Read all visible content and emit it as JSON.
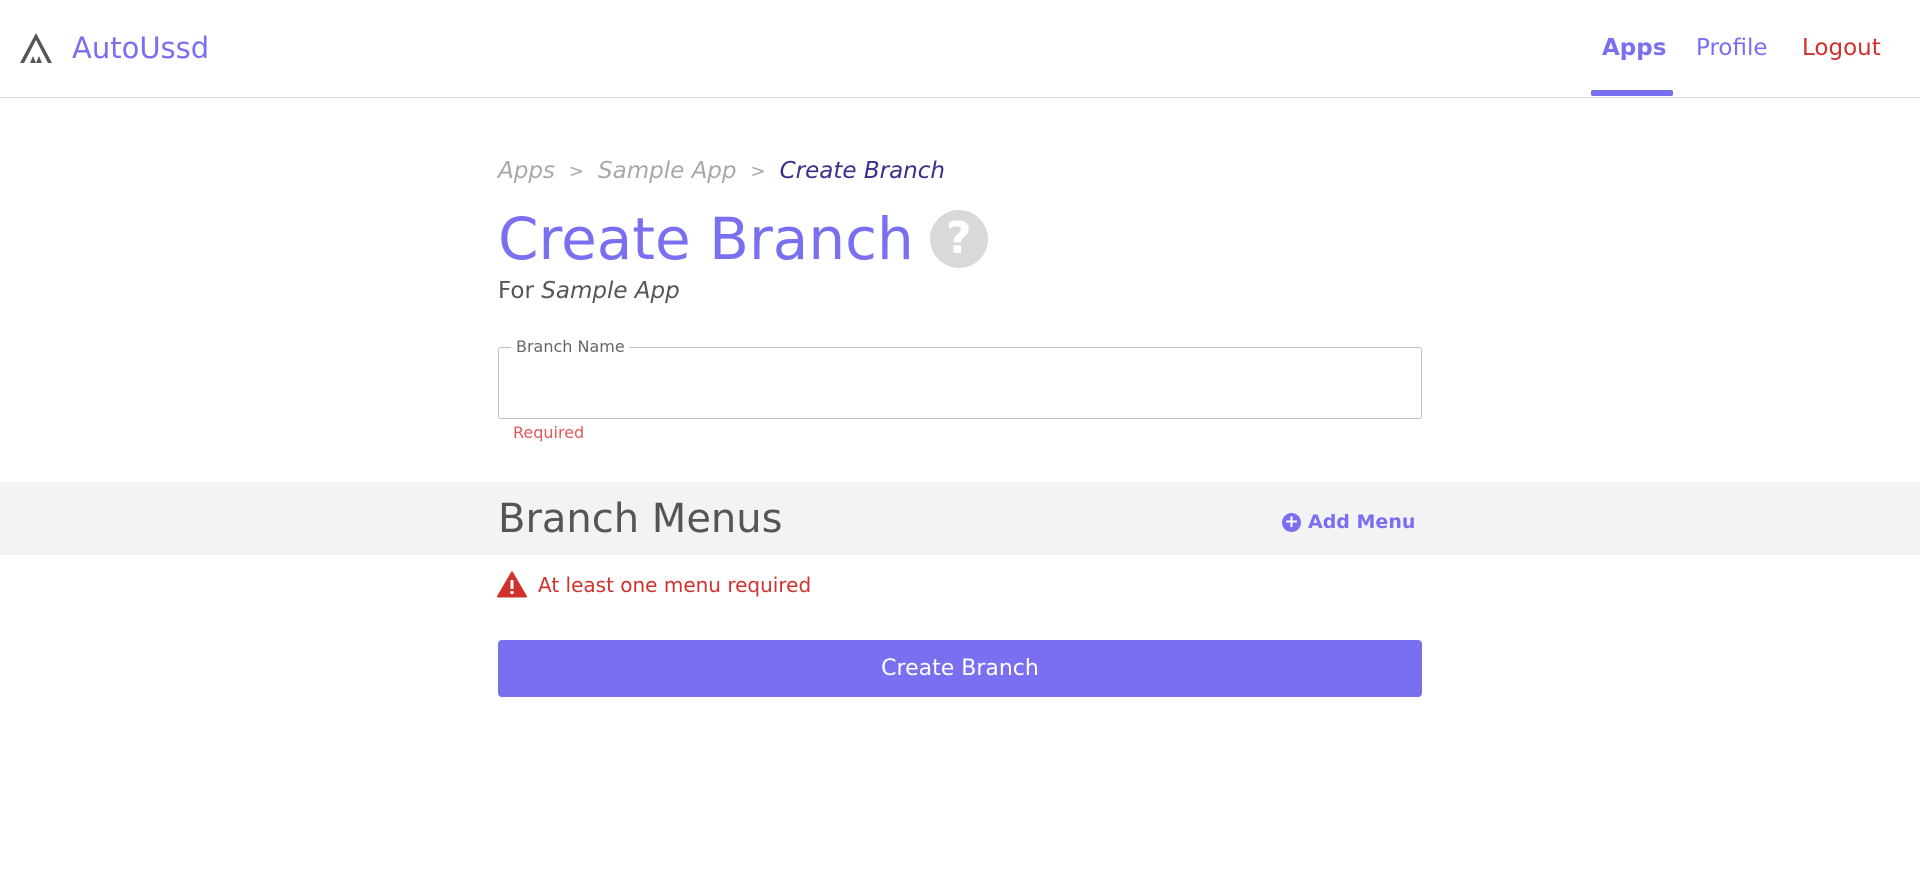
{
  "colors": {
    "accent": "#7a6ff0",
    "danger": "#d0312d",
    "error_soft": "#e0585c",
    "breadcrumb_current": "#3a2e8c",
    "muted": "#a8a8a8",
    "band": "#f3f3f3"
  },
  "header": {
    "brand_name": "AutoUssd",
    "logo_icon": "mountain-logo-icon",
    "nav": {
      "apps": "Apps",
      "profile": "Profile",
      "logout": "Logout",
      "active": "Apps"
    }
  },
  "breadcrumb": {
    "items": [
      "Apps",
      "Sample App"
    ],
    "separator": ">",
    "current": "Create Branch"
  },
  "page": {
    "title": "Create Branch",
    "help_icon": "question-circle-icon",
    "help_glyph": "?",
    "subtitle_prefix": "For",
    "subtitle_app": "Sample App"
  },
  "form": {
    "branch_name_label": "Branch Name",
    "branch_name_value": "",
    "branch_name_error": "Required"
  },
  "menus": {
    "title": "Branch Menus",
    "add_label": "Add Menu",
    "add_icon": "plus-circle-icon",
    "add_glyph": "+",
    "warning_icon": "warning-triangle-icon",
    "warning_text": "At least one menu required"
  },
  "submit_label": "Create Branch"
}
